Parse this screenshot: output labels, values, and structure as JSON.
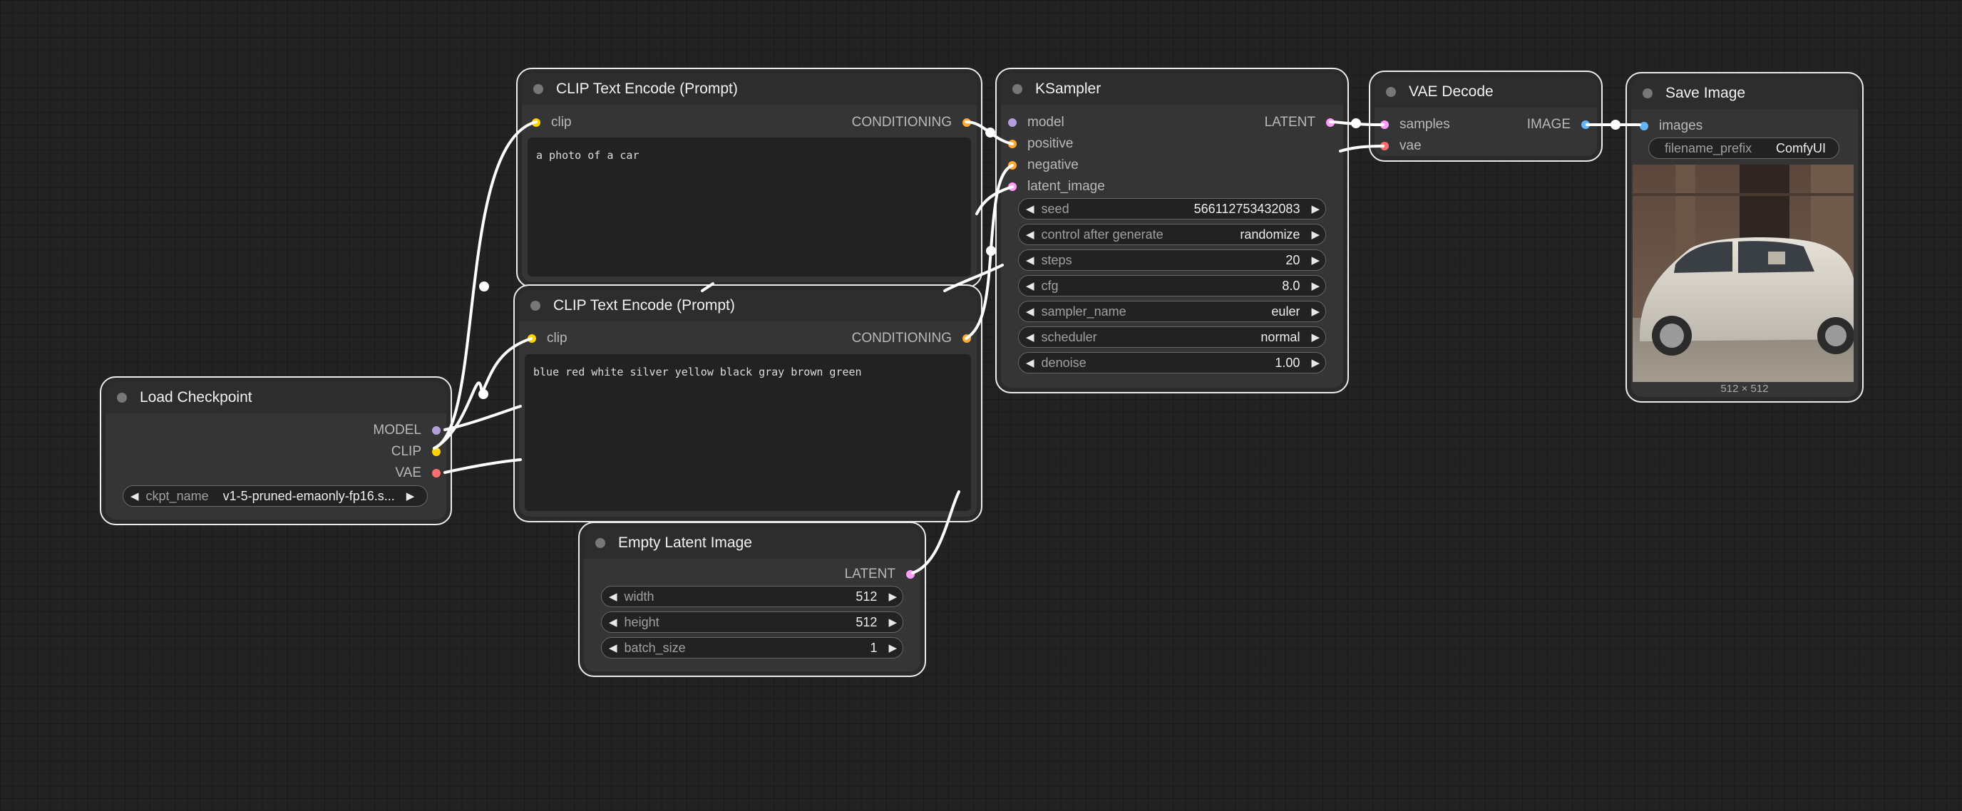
{
  "nodes": {
    "load_checkpoint": {
      "title": "Load Checkpoint",
      "outputs": {
        "model": "MODEL",
        "clip": "CLIP",
        "vae": "VAE"
      },
      "ckpt_label": "ckpt_name",
      "ckpt_value": "v1-5-pruned-emaonly-fp16.s..."
    },
    "clip_pos": {
      "title": "CLIP Text Encode (Prompt)",
      "input_clip": "clip",
      "output": "CONDITIONING",
      "text": "a photo of a car"
    },
    "clip_neg": {
      "title": "CLIP Text Encode (Prompt)",
      "input_clip": "clip",
      "output": "CONDITIONING",
      "text": "blue red white silver yellow black gray brown green"
    },
    "ksampler": {
      "title": "KSampler",
      "inputs": {
        "model": "model",
        "positive": "positive",
        "negative": "negative",
        "latent_image": "latent_image"
      },
      "output": "LATENT",
      "widgets": [
        {
          "label": "seed",
          "value": "566112753432083"
        },
        {
          "label": "control after generate",
          "value": "randomize"
        },
        {
          "label": "steps",
          "value": "20"
        },
        {
          "label": "cfg",
          "value": "8.0"
        },
        {
          "label": "sampler_name",
          "value": "euler"
        },
        {
          "label": "scheduler",
          "value": "normal"
        },
        {
          "label": "denoise",
          "value": "1.00"
        }
      ]
    },
    "vae_decode": {
      "title": "VAE Decode",
      "inputs": {
        "samples": "samples",
        "vae": "vae"
      },
      "output": "IMAGE"
    },
    "save_image": {
      "title": "Save Image",
      "input_images": "images",
      "prefix_label": "filename_prefix",
      "prefix_value": "ComfyUI",
      "image_size": "512 × 512"
    },
    "empty_latent": {
      "title": "Empty Latent Image",
      "output": "LATENT",
      "widgets": [
        {
          "label": "width",
          "value": "512"
        },
        {
          "label": "height",
          "value": "512"
        },
        {
          "label": "batch_size",
          "value": "1"
        }
      ]
    }
  },
  "colors": {
    "background": "#222222",
    "node_body": "#353535",
    "node_header": "#2d2d2d",
    "model_slot": "#b39ddb",
    "clip_slot": "#ffd500",
    "vae_slot": "#ff6e6e",
    "conditioning_slot": "#ffa931",
    "latent_slot": "#ff9cf9",
    "image_slot": "#64b5f6",
    "link": "#ffffff"
  },
  "icons": {
    "decrement": "left-triangle-icon",
    "increment": "right-triangle-icon"
  }
}
